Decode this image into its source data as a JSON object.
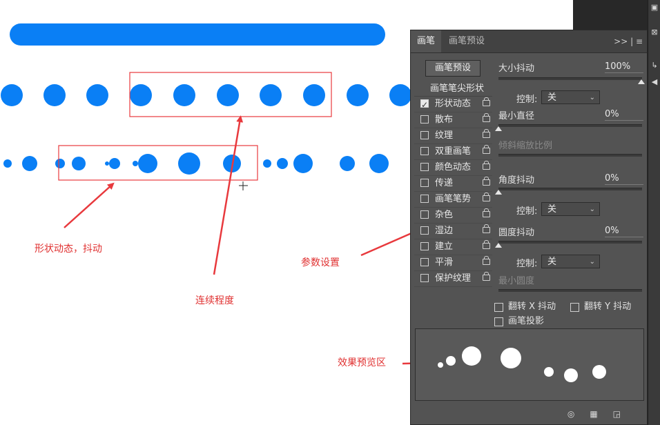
{
  "panel": {
    "tabs": [
      "画笔",
      "画笔预设"
    ],
    "tab_tools": ">>  |  ≡",
    "preset_button": "画笔预设",
    "tip_header": "画笔笔尖形状",
    "tip_items": [
      {
        "label": "形状动态",
        "checked": true
      },
      {
        "label": "散布",
        "checked": false
      },
      {
        "label": "纹理",
        "checked": false
      },
      {
        "label": "双重画笔",
        "checked": false
      },
      {
        "label": "颜色动态",
        "checked": false
      },
      {
        "label": "传递",
        "checked": false
      },
      {
        "label": "画笔笔势",
        "checked": false
      },
      {
        "label": "杂色",
        "checked": false
      },
      {
        "label": "湿边",
        "checked": false
      },
      {
        "label": "建立",
        "checked": false
      },
      {
        "label": "平滑",
        "checked": false
      },
      {
        "label": "保护纹理",
        "checked": false
      }
    ],
    "size_jitter": {
      "label": "大小抖动",
      "value": "100%",
      "level": 1.0
    },
    "control1": {
      "label": "控制:",
      "value": "关"
    },
    "min_diameter": {
      "label": "最小直径",
      "value": "0%",
      "level": 0
    },
    "tilt_scale": {
      "label": "倾斜缩放比例"
    },
    "angle_jitter": {
      "label": "角度抖动",
      "value": "0%",
      "level": 0
    },
    "control2": {
      "label": "控制:",
      "value": "关"
    },
    "roundness_jitter": {
      "label": "圆度抖动",
      "value": "0%",
      "level": 0
    },
    "control3": {
      "label": "控制:",
      "value": "关"
    },
    "min_roundness": {
      "label": "最小圆度"
    },
    "flip_x": "翻转 X 抖动",
    "flip_y": "翻转 Y 抖动",
    "brush_projection": "画笔投影"
  },
  "annotations": {
    "shape_dynamics": "形状动态，抖动",
    "continuity": "连续程度",
    "params": "参数设置",
    "preview": "效果预览区"
  },
  "colors": {
    "brush_blue": "#0a7ff5",
    "annotation_red": "#e8393d",
    "panel_bg": "#535353"
  }
}
